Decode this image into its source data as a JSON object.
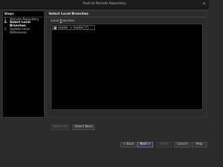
{
  "window": {
    "title": "Push to Remote Repository"
  },
  "steps": {
    "title": "Steps",
    "items": [
      {
        "num": "1.",
        "label": "Remote Repository"
      },
      {
        "num": "2.",
        "label": "Select Local Branches"
      },
      {
        "num": "3.",
        "label": "Update Local References"
      }
    ]
  },
  "main": {
    "title": "Select Local Branches",
    "list_label_prefix": "Local ",
    "list_label_mnemonic": "B",
    "list_label_suffix": "ranches:",
    "branches": [
      {
        "label": "master -> master [*]",
        "checked": true
      }
    ],
    "select_all_label": "Select All",
    "select_none_label": "Select None"
  },
  "footer": {
    "back_label": "< Back",
    "next_label": "Next >",
    "finish_label": "Finish",
    "cancel_label": "Cancel",
    "help_label": "Help"
  }
}
